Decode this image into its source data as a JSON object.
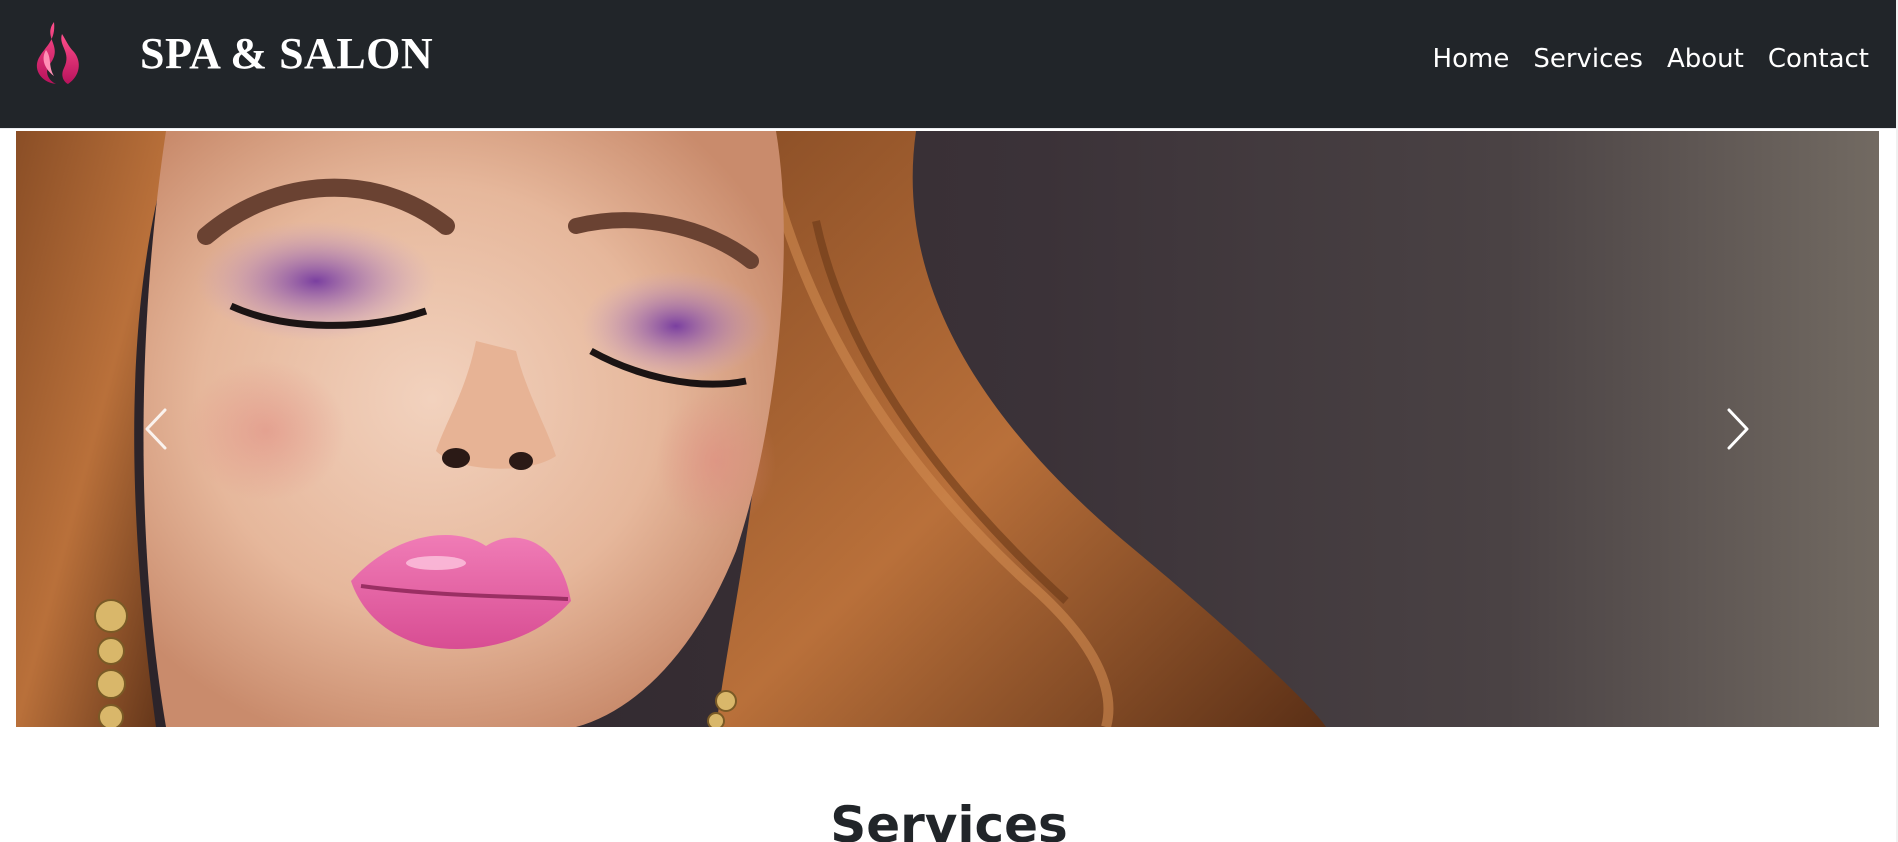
{
  "header": {
    "brand_name": "SPA & SALON",
    "logo_icon": "flame-logo-icon",
    "nav": [
      {
        "label": "Home"
      },
      {
        "label": "Services"
      },
      {
        "label": "About"
      },
      {
        "label": "Contact"
      }
    ]
  },
  "carousel": {
    "prev_icon": "chevron-left-icon",
    "next_icon": "chevron-right-icon"
  },
  "services": {
    "heading": "Services"
  },
  "colors": {
    "navbar_bg": "#212529",
    "logo_pink": "#e83e8c",
    "nav_text": "#ffffff"
  }
}
